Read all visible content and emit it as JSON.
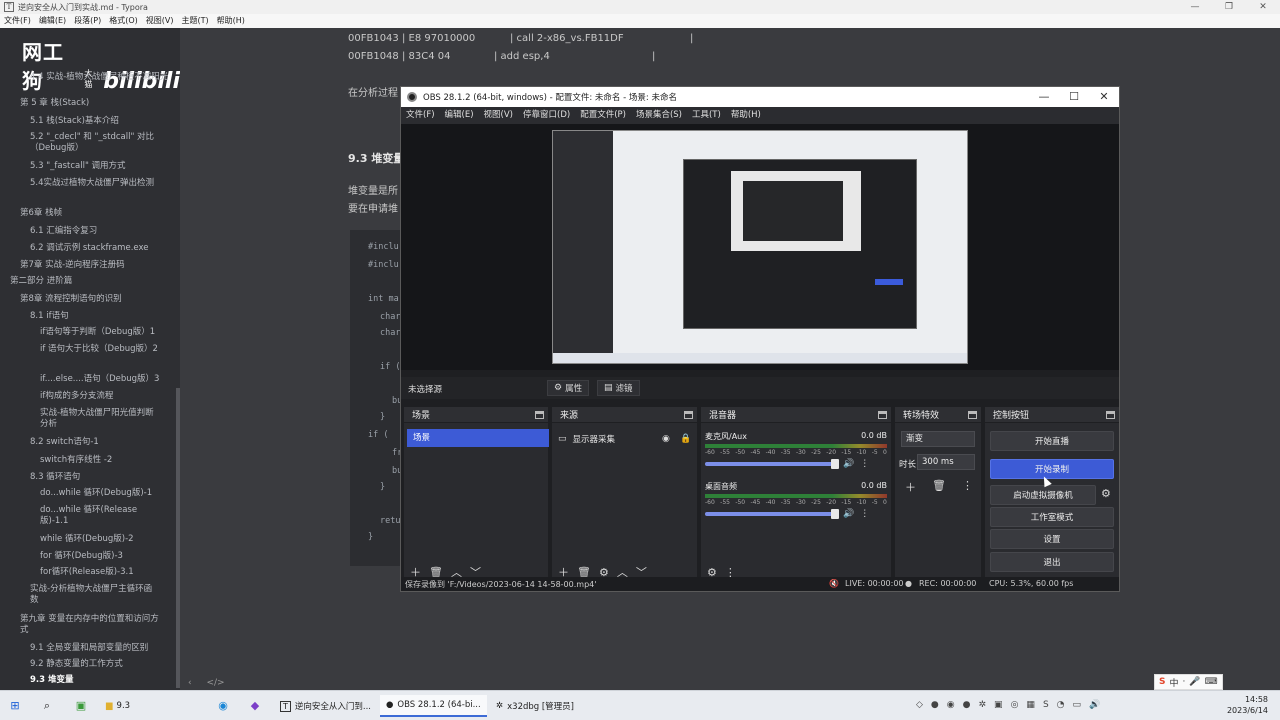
{
  "typora": {
    "title": "逆向安全从入门到实战.md - Typora",
    "menu": [
      "文件(F)",
      "编辑(E)",
      "段落(P)",
      "格式(O)",
      "视图(V)",
      "主题(T)",
      "帮助(H)"
    ],
    "window_buttons": [
      "—",
      "❐",
      "✕"
    ]
  },
  "brand": {
    "text": "网工狗",
    "sub": "大猫",
    "bili": "bilibili"
  },
  "toc": [
    {
      "text": "4.4 实战-植物大战僵尸种植不减阳光",
      "active": false
    },
    {
      "text": "第 5 章 栈(Stack)",
      "active": false
    },
    {
      "text": "5.1 栈(Stack)基本介绍",
      "active": false
    },
    {
      "text": "5.2 \"_cdecl\" 和 \"_stdcall\" 对比（Debug版）",
      "active": false
    },
    {
      "text": "5.3 \"_fastcall\" 调用方式",
      "active": false
    },
    {
      "text": "5.4实战过植物大战僵尸弹出检测",
      "active": false
    },
    {
      "text": "第6章 栈帧",
      "active": false
    },
    {
      "text": "6.1 汇编指令复习",
      "active": false
    },
    {
      "text": "6.2 调试示例 stackframe.exe",
      "active": false
    },
    {
      "text": "第7章 实战-逆向程序注册码",
      "active": false
    },
    {
      "text": "第二部分 进阶篇",
      "active": false
    },
    {
      "text": "第8章 流程控制语句的识别",
      "active": false
    },
    {
      "text": "8.1 if语句",
      "active": false
    },
    {
      "text": "if语句等于判断（Debug版）1",
      "active": false
    },
    {
      "text": "if 语句大于比较（Debug版）2",
      "active": false
    },
    {
      "text": "if....else....语句（Debug版）3",
      "active": false
    },
    {
      "text": "if构成的多分支流程",
      "active": false
    },
    {
      "text": "实战-植物大战僵尸阳光值判断分析",
      "active": false
    },
    {
      "text": "8.2 switch语句-1",
      "active": false
    },
    {
      "text": "switch有序线性 -2",
      "active": false
    },
    {
      "text": "8.3 循环语句",
      "active": false
    },
    {
      "text": "do...while 循环(Debug版)-1",
      "active": false
    },
    {
      "text": "do...while 循环(Release版)-1.1",
      "active": false
    },
    {
      "text": "while 循环(Debug版)-2",
      "active": false
    },
    {
      "text": "for 循环(Debug版)-3",
      "active": false
    },
    {
      "text": "for循环(Release版)-3.1",
      "active": false
    },
    {
      "text": "实战-分析植物大战僵尸主循环函数",
      "active": false
    },
    {
      "text": "第九章 变量在内存中的位置和访问方式",
      "active": false
    },
    {
      "text": "9.1 全局变量和局部变量的区别",
      "active": false
    },
    {
      "text": "9.2 静态变量的工作方式",
      "active": false
    },
    {
      "text": "9.3 堆变量",
      "active": true
    }
  ],
  "editor": {
    "asm1_addr": "00FB1043 | E8 97010000",
    "asm1_op": "| call 2-x86_vs.FB11DF",
    "asm1_tail": "|",
    "asm2_addr": "00FB1048 | 83C4 04",
    "asm2_op": "| add esp,4",
    "asm2_tail": "|",
    "para1": "在分析过程",
    "heading": "9.3 堆变量",
    "para2a": "堆变量是所",
    "para2b": "要在申请堆",
    "code": [
      "#inclu",
      "#inclu",
      "int ma",
      "char",
      "char",
      "if (",
      "bu",
      "}",
      "if (",
      "fr",
      "bu",
      "}",
      "retu",
      "}"
    ],
    "status_left": "‹",
    "status_right": "</>"
  },
  "obs": {
    "title": "OBS 28.1.2 (64-bit, windows) - 配置文件: 未命名 - 场景: 未命名",
    "window_buttons": [
      "—",
      "☐",
      "✕"
    ],
    "menu": [
      "文件(F)",
      "编辑(E)",
      "视图(V)",
      "停靠窗口(D)",
      "配置文件(P)",
      "场景集合(S)",
      "工具(T)",
      "帮助(H)"
    ],
    "context": {
      "no_source": "未选择源",
      "properties": "属性",
      "filters": "滤镜"
    },
    "docks": {
      "scenes": {
        "title": "场景",
        "items": [
          "场景"
        ]
      },
      "sources": {
        "title": "来源",
        "items": [
          "显示器采集"
        ]
      },
      "mixer": {
        "title": "混音器",
        "channels": [
          {
            "name": "麦克风/Aux",
            "db": "0.0 dB",
            "level": 0.92
          },
          {
            "name": "桌面音频",
            "db": "0.0 dB",
            "level": 0.92
          }
        ],
        "ticks": [
          "-60",
          "-55",
          "-50",
          "-45",
          "-40",
          "-35",
          "-30",
          "-25",
          "-20",
          "-15",
          "-10",
          "-5",
          "0"
        ]
      },
      "transitions": {
        "title": "转场特效",
        "type": "渐变",
        "duration_label": "时长",
        "duration": "300 ms"
      },
      "controls": {
        "title": "控制按钮",
        "buttons": [
          "开始直播",
          "开始录制",
          "启动虚拟摄像机",
          "工作室模式",
          "设置",
          "退出"
        ]
      }
    },
    "status": {
      "saved": "保存录像到 'F:/Videos/2023-06-14 14-58-00.mp4'",
      "live": "LIVE: 00:00:00",
      "rec": "REC: 00:00:00",
      "cpu": "CPU: 5.3%, 60.00 fps"
    }
  },
  "taskbar": {
    "apps": [
      {
        "label": "9.3",
        "icon": "folder-icon"
      },
      {
        "label": "逆向安全从入门到...",
        "icon": "typora-icon"
      },
      {
        "label": "OBS 28.1.2 (64-bi...",
        "icon": "obs-icon"
      },
      {
        "label": "x32dbg [管理员]",
        "icon": "x32dbg-icon"
      }
    ],
    "time": "14:58",
    "date": "2023/6/14",
    "ime": [
      "S",
      "中",
      "·",
      "🎤",
      "⌨"
    ]
  }
}
